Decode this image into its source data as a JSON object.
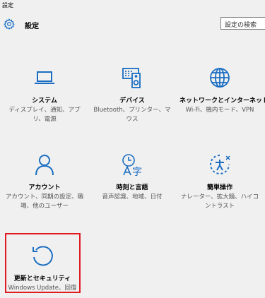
{
  "window": {
    "title": "設定"
  },
  "header": {
    "app_title": "設定",
    "search_label": "設定の検索"
  },
  "colors": {
    "accent": "#1b6ec2",
    "highlight": "#e01b22"
  },
  "tiles": [
    {
      "name": "システム",
      "desc": "ディスプレイ、通知、アプリ、電源",
      "icon": "laptop-icon"
    },
    {
      "name": "デバイス",
      "desc": "Bluetooth、プリンター、マウス",
      "icon": "devices-icon"
    },
    {
      "name": "ネットワークとインターネット",
      "desc": "Wi-Fi、機内モード、VPN",
      "icon": "globe-icon"
    },
    {
      "name": "アカウント",
      "desc": "アカウント、同期の設定、職場、他のユーザー",
      "icon": "person-icon"
    },
    {
      "name": "時刻と言語",
      "desc": "音声認識、地域、日付",
      "icon": "time-language-icon"
    },
    {
      "name": "簡単操作",
      "desc": "ナレーター、拡大鏡、ハイコントラスト",
      "icon": "ease-of-access-icon"
    },
    {
      "name": "更新とセキュリティ",
      "desc": "Windows Update、回復",
      "icon": "update-icon"
    }
  ]
}
